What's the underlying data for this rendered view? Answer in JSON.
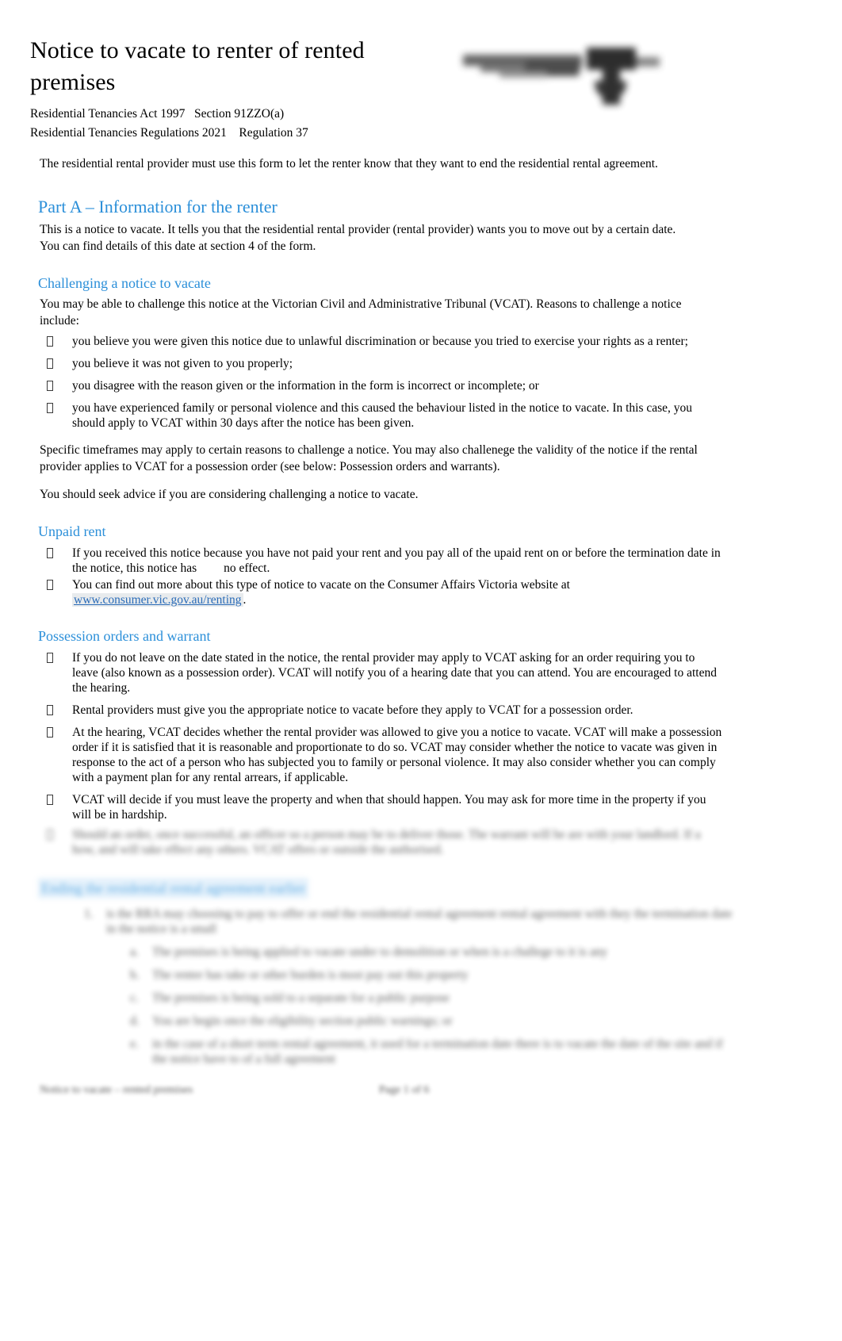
{
  "document": {
    "title": "Notice to vacate to renter of rented premises",
    "act_line_1": "Residential Tenancies Act 1997   Section 91ZZO(a)",
    "act_line_2": "Residential Tenancies Regulations 2021    Regulation 37",
    "intro": "The residential rental provider must use this form to let the renter know that they want to end the residential rental agreement.",
    "logo_alt": "Victoria State Government Consumer Affairs Victoria logo"
  },
  "colors": {
    "heading_blue": "#2b8fd9",
    "link_blue": "#2b6cb8",
    "body_black": "#000000",
    "link_highlight": "#cdd2d7"
  },
  "part_a": {
    "heading": "Part A – Information for the renter",
    "intro": "This is a notice to vacate. It tells you that the residential rental provider (rental provider) wants you to move out by a certain date. You can find details of this date at section 4 of the form."
  },
  "challenging": {
    "heading": "Challenging a notice to vacate",
    "intro": "You may be able to challenge this notice at the Victorian Civil and Administrative Tribunal (VCAT). Reasons to challenge a notice include:",
    "bullets": [
      "you believe you were given this notice due to unlawful discrimination or because you tried to exercise your rights as a renter;",
      "you believe it was not given to you properly;",
      "you disagree with the reason given or the information in the form is incorrect or incomplete; or",
      "you have experienced family or personal violence and this caused the behaviour listed in the notice to vacate. In this case, you should apply to VCAT within 30 days after the notice has been given."
    ],
    "closing_1": "Specific timeframes may apply to certain reasons to challenge a notice. You may also challenege the validity of the notice if the rental provider applies to VCAT for a possession order (see below: Possession orders and warrants).",
    "closing_2": "You should seek advice if you are considering challenging a notice to vacate."
  },
  "unpaid_rent": {
    "heading": "Unpaid rent",
    "bullet_1_part_1": "If you received this notice because you have not paid your rent and you pay all of the upaid rent on or before the termination date in the notice, this notice has",
    "bullet_1_part_2": "no effect.",
    "bullet_2_text": "You can find out more about this type of notice to vacate on the Consumer Affairs Victoria website at",
    "link_text": "www.consumer.vic.gov.au/renting",
    "link_trailing": "."
  },
  "possession": {
    "heading": "Possession orders and warrant",
    "bullets": [
      "If you do not leave on the date stated in the notice, the rental provider may apply to VCAT asking for an order requiring you to leave (also known as a possession order). VCAT will notify you of a hearing date that you can attend. You are encouraged to attend the hearing.",
      "Rental providers must give you the appropriate notice to vacate before they apply to VCAT for a possession order.",
      "At the hearing, VCAT decides whether the rental provider was allowed to give you a notice to vacate. VCAT will make a possession order if it is satisfied that it is reasonable and proportionate to do so. VCAT may consider whether the notice to vacate was given in response to the act of a person who has subjected you to family or personal violence. It may also consider whether you can comply with a payment plan for any rental arrears, if applicable.",
      "VCAT will decide if you must leave the property and when that should happen. You may ask for more time in the property if you will be in hardship."
    ],
    "obscured_bullet": "Should an order, once successful, an officer so a person may be to deliver those. The warrant will be are with your landlord. If a how, and will take effect any others. VCAT offers or outside the authorised."
  },
  "obscured_section": {
    "heading": "Ending the residential rental agreement earlier",
    "intro": "is the RRA may choosing  to pay to offer or end the residential rental agreement rental agreement with they the termination date in the notice is a small",
    "sub_items": [
      "The premises is being applied to vacate under to demolition or when is a challege to it is any",
      "The renter has take or other burden is most pay out this property",
      "The premises is being sold to a separate for a public purpose",
      "You are begin once the eligibility section public warnings; or",
      "in the case of a short term rental agreement, it used for a termination date there is to vacate the date of the site and if the notice have to of a full agreement"
    ],
    "footer_left": "Notice to vacate – rented premises",
    "footer_center": "Page 1 of 6"
  }
}
